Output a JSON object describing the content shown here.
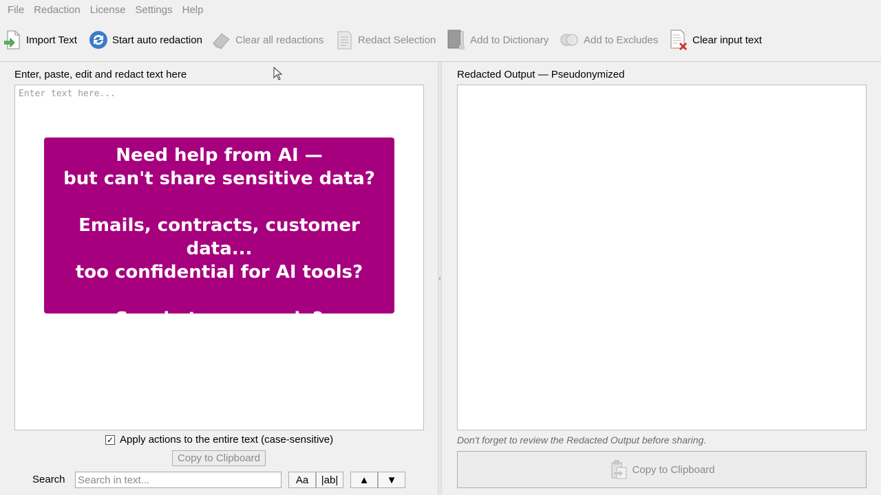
{
  "menu": [
    "File",
    "Redaction",
    "License",
    "Settings",
    "Help"
  ],
  "toolbar": {
    "import_text": "Import Text",
    "start_auto": "Start auto redaction",
    "clear_all": "Clear all redactions",
    "redact_selection": "Redact Selection",
    "add_dictionary": "Add to Dictionary",
    "add_excludes": "Add to Excludes",
    "clear_input": "Clear input text"
  },
  "left_panel": {
    "label": "Enter, paste, edit and redact text here",
    "placeholder": "Enter text here...",
    "promo": {
      "line1": "Need help from AI —",
      "line2": "but can't share sensitive data?",
      "line3": "Emails, contracts, customer data...",
      "line4": "too confidential for AI tools?",
      "line5": "So what can you do?"
    },
    "apply_checkbox_label": "Apply actions to the entire text (case-sensitive)",
    "apply_checked": true,
    "copy_button": "Copy to Clipboard",
    "search_label": "Search",
    "search_placeholder": "Search in text...",
    "match_case": "Aa",
    "whole_word": "|ab|",
    "prev": "▲",
    "next": "▼"
  },
  "right_panel": {
    "label": "Redacted Output — Pseudonymized",
    "review_note": "Don't forget to review the Redacted Output before sharing.",
    "copy_button": "Copy to Clipboard"
  },
  "colors": {
    "promo_bg": "#a7007e",
    "window_bg": "#f0f0f0",
    "disabled_text": "#8c8c8c"
  },
  "icons": [
    "import-icon",
    "sync-icon",
    "eraser-icon",
    "document-icon",
    "book-icon",
    "exclude-icon",
    "clear-document-icon",
    "clipboard-icon"
  ]
}
